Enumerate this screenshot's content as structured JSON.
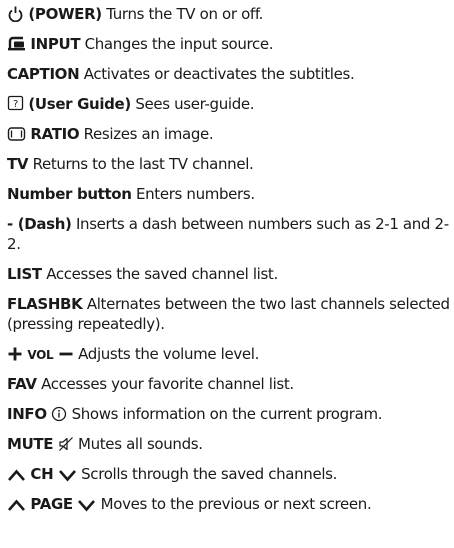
{
  "entries": [
    {
      "icon": "power-icon",
      "key": "(POWER)",
      "desc": "Turns the TV on or off."
    },
    {
      "icon": "input-icon",
      "key": "INPUT",
      "desc": "Changes the input source."
    },
    {
      "key": "CAPTION",
      "desc": "Activates or deactivates the subtitles."
    },
    {
      "icon": "user-guide-icon",
      "key": "(User Guide)",
      "desc": "Sees user-guide."
    },
    {
      "icon": "ratio-icon",
      "key": "RATIO",
      "desc": "Resizes an image."
    },
    {
      "key": "TV",
      "desc": "Returns to the last TV channel."
    },
    {
      "key": "Number button",
      "desc": "Enters numbers."
    },
    {
      "key": "- (Dash)",
      "desc": "Inserts a dash between numbers such as 2-1 and 2-2."
    },
    {
      "key": "LIST",
      "desc": "Accesses the saved channel list."
    },
    {
      "key": "FLASHBK",
      "desc": "Alternates between the two last channels selected (pressing repeatedly)."
    },
    {
      "icons": [
        "plus-icon",
        "minus-icon"
      ],
      "key": "VOL",
      "desc": "Adjusts the volume level."
    },
    {
      "key": "FAV",
      "desc": "Accesses your favorite channel list."
    },
    {
      "icon": "info-icon",
      "key": "INFO",
      "desc": "Shows information on the current program."
    },
    {
      "icon": "mute-icon",
      "key": "MUTE",
      "desc": "Mutes all sounds."
    },
    {
      "icons": [
        "chevron-up-icon",
        "chevron-down-icon"
      ],
      "key": "CH",
      "desc": "Scrolls through the saved channels."
    },
    {
      "icons": [
        "chevron-up-icon",
        "chevron-down-icon"
      ],
      "key": "PAGE",
      "desc": "Moves to the previous or next screen."
    }
  ]
}
